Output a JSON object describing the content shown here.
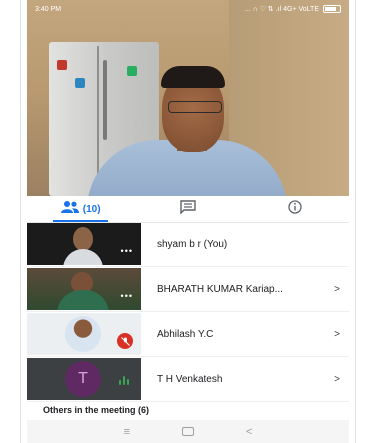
{
  "status_bar": {
    "time": "3:40 PM",
    "signal": "... ∩ ♡ ⇅ .ıl 4G+ VoLTE"
  },
  "tabs": [
    {
      "icon": "people-icon",
      "label": "(10)",
      "active": true
    },
    {
      "icon": "chat-icon",
      "label": "",
      "active": false
    },
    {
      "icon": "info-icon",
      "label": "",
      "active": false
    }
  ],
  "participants": [
    {
      "name": "shyam b r (You)",
      "chevron": ""
    },
    {
      "name": "BHARATH KUMAR Kariap...",
      "chevron": ">"
    },
    {
      "name": "Abhilash Y.C",
      "chevron": ">"
    },
    {
      "name": "T H Venkatesh",
      "chevron": ">"
    }
  ],
  "avatar_initial": "T",
  "others_label": "Others in the meeting (6)",
  "nav": {
    "menu": "≡",
    "back": "<"
  },
  "colors": {
    "accent": "#1a73e8",
    "mute": "#d93025",
    "speaking": "#34a853",
    "avatar": "#5f2a64"
  }
}
